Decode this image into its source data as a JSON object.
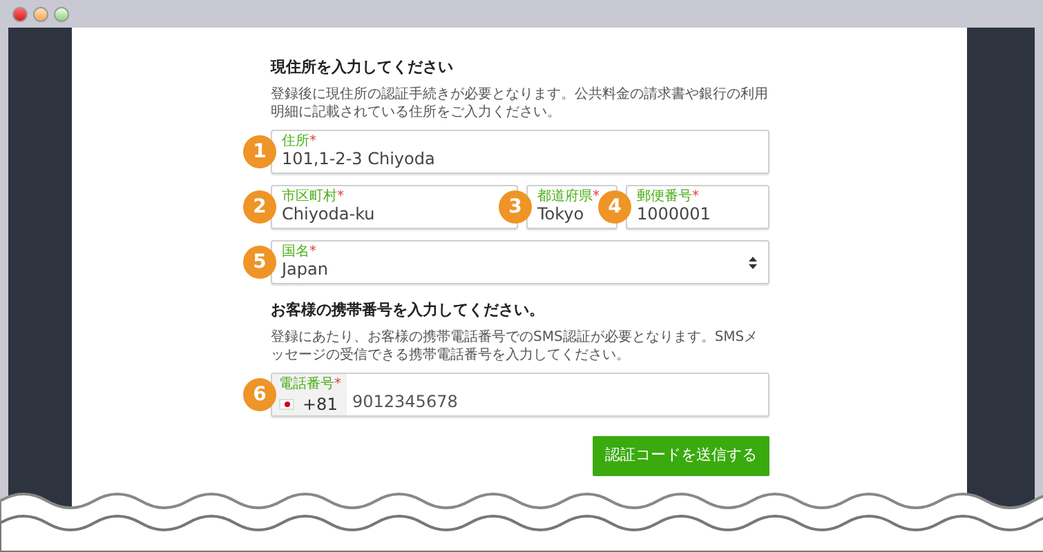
{
  "sections": [
    {
      "heading": "現住所を入力してください",
      "text": "登録後に現住所の認証手続きが必要となります。公共料金の請求書や銀行の利用明細に記載されている住所をご入力ください。",
      "rows": [
        [
          {
            "kind": "text",
            "badge": "1",
            "label": "住所",
            "mark": "*",
            "value": "101,1-2-3 Chiyoda"
          }
        ],
        [
          {
            "kind": "text",
            "badge": "2",
            "label": "市区町村",
            "mark": "*",
            "value": "Chiyoda-ku"
          },
          {
            "kind": "text",
            "badge": "3",
            "label": "都道府県",
            "mark": "*",
            "value": "Tokyo"
          },
          {
            "kind": "text",
            "badge": "4",
            "label": "郵便番号",
            "mark": "*",
            "value": "1000001"
          }
        ],
        [
          {
            "kind": "select",
            "badge": "5",
            "label": "国名",
            "mark": "*",
            "value": "Japan"
          }
        ]
      ]
    },
    {
      "heading": "お客様の携帯番号を入力してください。",
      "text": "登録にあたり、お客様の携帯電話番号でのSMS認証が必要となります。SMSメッセージの受信できる携帯電話番号を入力してください。",
      "rows": [
        [
          {
            "kind": "phone",
            "badge": "6",
            "label": "電話番号",
            "mark": "*",
            "code": "+81",
            "value": "9012345678"
          }
        ]
      ]
    }
  ],
  "submit": "認証コードを送信する"
}
